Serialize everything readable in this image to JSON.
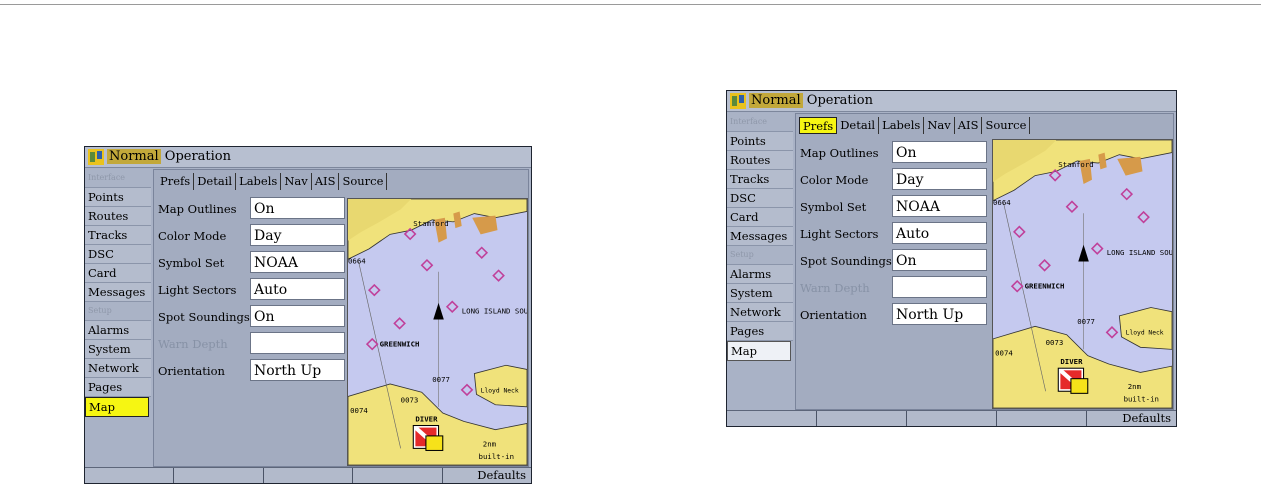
{
  "window_title_parts": [
    "Normal",
    " Operation"
  ],
  "sidebar": {
    "items": [
      {
        "label": "Interface",
        "type": "hdr"
      },
      {
        "label": "Points"
      },
      {
        "label": "Routes"
      },
      {
        "label": "Tracks"
      },
      {
        "label": "DSC"
      },
      {
        "label": "Card"
      },
      {
        "label": "Messages"
      },
      {
        "label": "Setup",
        "type": "hdr"
      },
      {
        "label": "Alarms"
      },
      {
        "label": "System"
      },
      {
        "label": "Network"
      },
      {
        "label": "Pages"
      },
      {
        "label": "Map",
        "type": "selected"
      }
    ]
  },
  "tabs": [
    "Prefs",
    "Detail",
    "Labels",
    "Nav",
    "AIS",
    "Source"
  ],
  "settings": [
    {
      "label": "Map Outlines",
      "value": "On"
    },
    {
      "label": "Color Mode",
      "value": "Day"
    },
    {
      "label": "Symbol Set",
      "value": "NOAA"
    },
    {
      "label": "Light Sectors",
      "value": "Auto"
    },
    {
      "label": "Spot Soundings",
      "value": "On"
    },
    {
      "label": "Warn Depth",
      "value": "",
      "disabled": true
    },
    {
      "label": "Orientation",
      "value": "North Up"
    }
  ],
  "softkeys": [
    "",
    "",
    "",
    "",
    "Defaults"
  ],
  "map_labels": {
    "place1": "Stamford",
    "place2": "GREENWICH",
    "sound": "LONG ISLAND SOU",
    "wp1": "0077",
    "wp2": "0073",
    "wp3": "0074",
    "wp4": "0664",
    "diver": "DIVER",
    "neck": "Lloyd Neck",
    "zoom": "2nm",
    "builtin": "built-in"
  },
  "colors": {
    "map_water": "#c5c9ef",
    "map_land": "#f0e27b",
    "map_urban": "#d69a4a",
    "waypoint": "#c0409a",
    "selection": "#f6f612",
    "panel": "#a9b2c6"
  },
  "screens": [
    {
      "id": "s1",
      "selected_tab": -1,
      "sidebar_selected_style": "yellow"
    },
    {
      "id": "s2",
      "selected_tab": 0,
      "sidebar_selected_style": "white"
    }
  ]
}
